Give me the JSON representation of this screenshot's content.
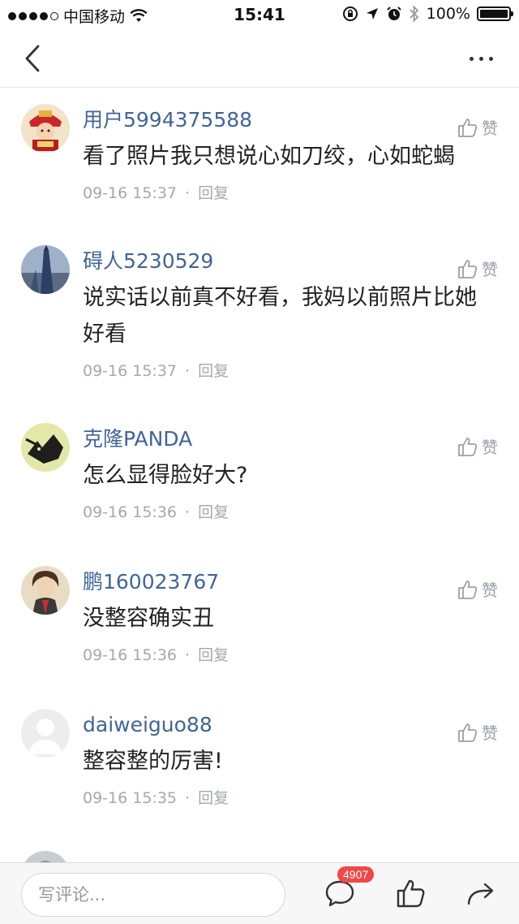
{
  "status_bar": {
    "carrier": "中国移动",
    "time": "15:41",
    "battery": "100%"
  },
  "comments": [
    {
      "username": "用户5994375588",
      "text": "看了照片我只想说心如刀绞，心如蛇蝎",
      "time": "09-16 15:37",
      "reply": "回复",
      "like": "赞",
      "avatar": "caishen-avatar"
    },
    {
      "username": "碍人5230529",
      "text": "说实话以前真不好看，我妈以前照片比她好看",
      "time": "09-16 15:37",
      "reply": "回复",
      "like": "赞",
      "avatar": "tower-avatar"
    },
    {
      "username": "克隆PANDA",
      "text": "怎么显得脸好大?",
      "time": "09-16 15:36",
      "reply": "回复",
      "like": "赞",
      "avatar": "cartoon-avatar"
    },
    {
      "username": "鹏160023767",
      "text": "没整容确实丑",
      "time": "09-16 15:36",
      "reply": "回复",
      "like": "赞",
      "avatar": "portrait-avatar"
    },
    {
      "username": "daiweiguo88",
      "text": "整容整的厉害!",
      "time": "09-16 15:35",
      "reply": "回复",
      "like": "赞",
      "avatar": "default-avatar"
    }
  ],
  "bottom_bar": {
    "input_placeholder": "写评论...",
    "comment_count": "4907"
  }
}
